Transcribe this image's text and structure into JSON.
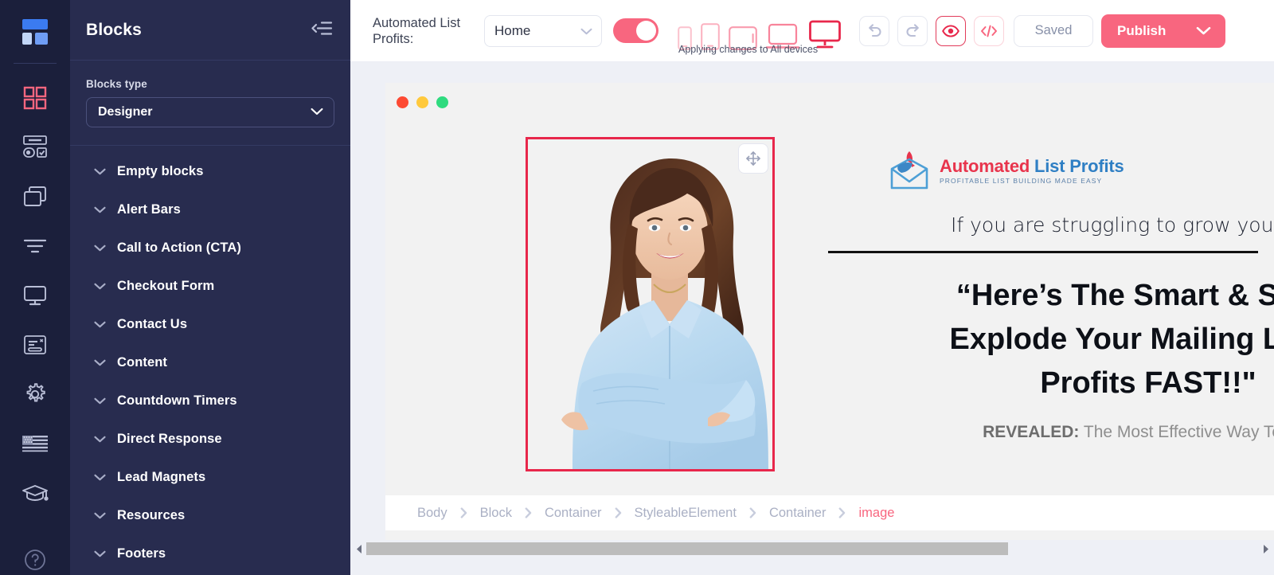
{
  "colors": {
    "rail_bg": "#1b1f3b",
    "panel_bg": "#282c4f",
    "accent_pink": "#f8667f",
    "accent_red": "#e8274b",
    "canvas_bg": "#eef0f6"
  },
  "rail": {
    "logo_name": "layout-grid-logo",
    "items": [
      {
        "name": "blocks-icon",
        "label": "Blocks",
        "active": true
      },
      {
        "name": "forms-icon",
        "label": "Forms",
        "active": false
      },
      {
        "name": "pages-icon",
        "label": "Pages",
        "active": false
      },
      {
        "name": "filters-icon",
        "label": "Filters",
        "active": false
      },
      {
        "name": "display-icon",
        "label": "Display",
        "active": false
      },
      {
        "name": "popup-icon",
        "label": "Popups",
        "active": false
      },
      {
        "name": "settings-gear-icon",
        "label": "Settings",
        "active": false
      },
      {
        "name": "language-flag-icon",
        "label": "Language",
        "active": false
      },
      {
        "name": "graduation-cap-icon",
        "label": "Training",
        "active": false
      }
    ],
    "help_label": "Help"
  },
  "panel": {
    "title": "Blocks",
    "collapse_icon": "collapse-left-icon",
    "blocks_type_label": "Blocks type",
    "blocks_type_value": "Designer",
    "categories": [
      {
        "label": "Empty blocks"
      },
      {
        "label": "Alert Bars"
      },
      {
        "label": "Call to Action (CTA)"
      },
      {
        "label": "Checkout Form"
      },
      {
        "label": "Contact Us"
      },
      {
        "label": "Content"
      },
      {
        "label": "Countdown Timers"
      },
      {
        "label": "Direct Response"
      },
      {
        "label": "Lead Magnets"
      },
      {
        "label": "Resources"
      },
      {
        "label": "Footers"
      }
    ]
  },
  "toolbar": {
    "site_name": "Automated List Profits:",
    "page_select_value": "Home",
    "preview_toggle_on": true,
    "devices_note": "Applying changes to All devices",
    "devices": [
      {
        "name": "device-mobile-portrait",
        "active": false
      },
      {
        "name": "device-mobile-landscape",
        "active": false
      },
      {
        "name": "device-tablet",
        "active": false
      },
      {
        "name": "device-laptop",
        "active": false
      },
      {
        "name": "device-desktop",
        "active": true
      }
    ],
    "undo_label": "Undo",
    "redo_label": "Redo",
    "preview_label": "Preview",
    "code_label": "Code",
    "saved_label": "Saved",
    "publish_label": "Publish"
  },
  "canvas": {
    "window_dots": [
      "close",
      "minimize",
      "maximize"
    ],
    "selected_element": "image",
    "move_handle_name": "move-handle-icon",
    "brand": {
      "line1_a": "Automated ",
      "line1_b": "List Profits",
      "tagline": "PROFITABLE LIST BUILDING MADE EASY"
    },
    "subhead": "If you are struggling to grow you",
    "headline_line1": "“Here’s The Smart & Simpl",
    "headline_line2": "Explode Your Mailing List &",
    "headline_line3": "Profits FAST!!\"",
    "revealed_label": "REVEALED:",
    "revealed_text": " The Most Effective Way To Gro"
  },
  "breadcrumb": {
    "items": [
      {
        "label": "Body",
        "active": false
      },
      {
        "label": "Block",
        "active": false
      },
      {
        "label": "Container",
        "active": false
      },
      {
        "label": "StyleableElement",
        "active": false
      },
      {
        "label": "Container",
        "active": false
      },
      {
        "label": "image",
        "active": true
      }
    ]
  },
  "scrollbar": {
    "left_arrow": "scroll-left-arrow",
    "right_arrow": "scroll-right-arrow",
    "thumb_percent": 72
  }
}
